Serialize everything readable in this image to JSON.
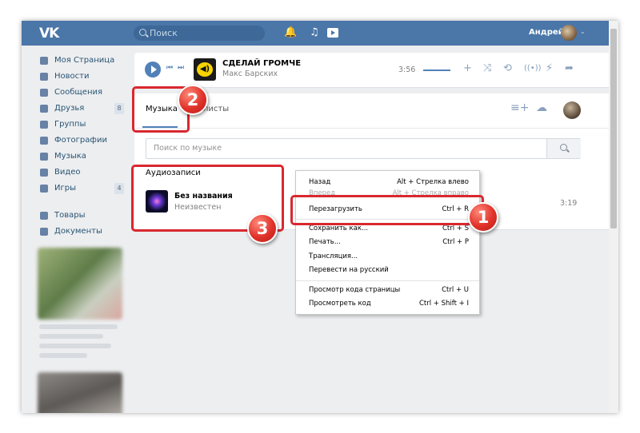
{
  "topbar": {
    "logo": "VK",
    "search_placeholder": "Поиск",
    "user_name": "Андрей",
    "icons": [
      "bell-icon",
      "music-note-icon",
      "video-play-icon"
    ]
  },
  "sidebar": {
    "items": [
      {
        "label": "Моя Страница",
        "icon": "home-icon"
      },
      {
        "label": "Новости",
        "icon": "news-icon"
      },
      {
        "label": "Сообщения",
        "icon": "chat-icon"
      },
      {
        "label": "Друзья",
        "icon": "user-icon",
        "count": "8"
      },
      {
        "label": "Группы",
        "icon": "group-icon"
      },
      {
        "label": "Фотографии",
        "icon": "camera-icon"
      },
      {
        "label": "Музыка",
        "icon": "music-note-icon"
      },
      {
        "label": "Видео",
        "icon": "video-icon"
      },
      {
        "label": "Игры",
        "icon": "gamepad-icon",
        "count": "4"
      }
    ],
    "extra": [
      {
        "label": "Товары",
        "icon": "bag-icon"
      },
      {
        "label": "Документы",
        "icon": "document-icon"
      }
    ]
  },
  "player": {
    "title": "СДЕЛАЙ ГРОМЧЕ",
    "artist": "Макс Барских",
    "time": "3:56"
  },
  "music": {
    "tab_music": "Музыка",
    "tab_playlists": "листы",
    "search_placeholder": "Поиск по музыке",
    "section_title": "Аудиозаписи",
    "track": {
      "title": "Без названия",
      "artist": "Неизвестен",
      "duration": "3:19"
    }
  },
  "context_menu": {
    "items": [
      {
        "label": "Назад",
        "shortcut": "Alt + Стрелка влево"
      },
      {
        "label": "Вперед",
        "shortcut": "Alt + Стрелка вправо"
      },
      {
        "label": "Перезагрузить",
        "shortcut": "Ctrl + R"
      },
      {
        "label": "Сохранить как...",
        "shortcut": "Ctrl + S"
      },
      {
        "label": "Печать...",
        "shortcut": "Ctrl + P"
      },
      {
        "label": "Трансляция...",
        "shortcut": ""
      },
      {
        "label": "Перевести на русский",
        "shortcut": ""
      },
      {
        "label": "Просмотр кода страницы",
        "shortcut": "Ctrl + U"
      },
      {
        "label": "Просмотреть код",
        "shortcut": "Ctrl + Shift + I"
      }
    ]
  },
  "annotations": {
    "badge_1": "1",
    "badge_2": "2",
    "badge_3": "3",
    "color": "#d9282f"
  }
}
